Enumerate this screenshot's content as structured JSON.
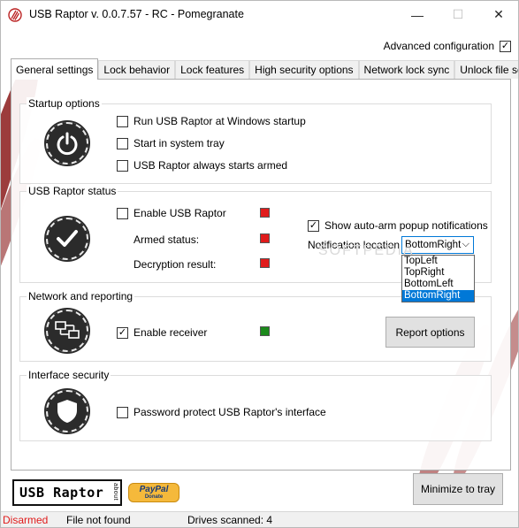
{
  "window": {
    "title": "USB Raptor v. 0.0.7.57 - RC - Pomegranate",
    "minimize_glyph": "—",
    "maximize_glyph": "☐",
    "close_glyph": "✕"
  },
  "advanced_config": {
    "label": "Advanced configuration",
    "checked": true,
    "check_glyph": "✓"
  },
  "tabs": [
    {
      "label": "General settings",
      "active": true
    },
    {
      "label": "Lock behavior"
    },
    {
      "label": "Lock features"
    },
    {
      "label": "High security options"
    },
    {
      "label": "Network lock sync"
    },
    {
      "label": "Unlock file settings"
    }
  ],
  "startup": {
    "title": "Startup options",
    "icon": "power-icon",
    "options": [
      {
        "label": "Run USB Raptor at Windows startup",
        "checked": false
      },
      {
        "label": "Start in system tray",
        "checked": false
      },
      {
        "label": "USB Raptor always starts armed",
        "checked": false
      }
    ]
  },
  "status": {
    "title": "USB Raptor status",
    "icon": "checkmark-icon",
    "enable_label": "Enable USB Raptor",
    "armed_label": "Armed status:",
    "decryption_label": "Decryption result:",
    "led_color": "#e01b1b",
    "popup_label": "Show auto-arm popup notifications",
    "popup_checked": true,
    "notif_location_label": "Notification location",
    "notif_selected": "BottomRight",
    "notif_options": [
      "TopLeft",
      "TopRight",
      "BottomLeft",
      "BottomRight"
    ],
    "chevron_glyph": "⌵"
  },
  "network": {
    "title": "Network and reporting",
    "icon": "network-computers-icon",
    "receiver_label": "Enable receiver",
    "receiver_checked": true,
    "led_color": "#1c8a1c",
    "report_button": "Report options"
  },
  "interface": {
    "title": "Interface security",
    "icon": "shield-icon",
    "password_label": "Password protect USB Raptor's interface",
    "checked": false
  },
  "footer": {
    "logo_text": "USB Raptor",
    "logo_about": "about",
    "paypal_text": "PayPal",
    "paypal_sub": "Donate",
    "minimize_tray": "Minimize to tray"
  },
  "statusbar": {
    "state": "Disarmed",
    "state_color": "#e01b1b",
    "file": "File not found",
    "drives": "Drives scanned: 4"
  },
  "watermark": "SOFTPEDIA"
}
